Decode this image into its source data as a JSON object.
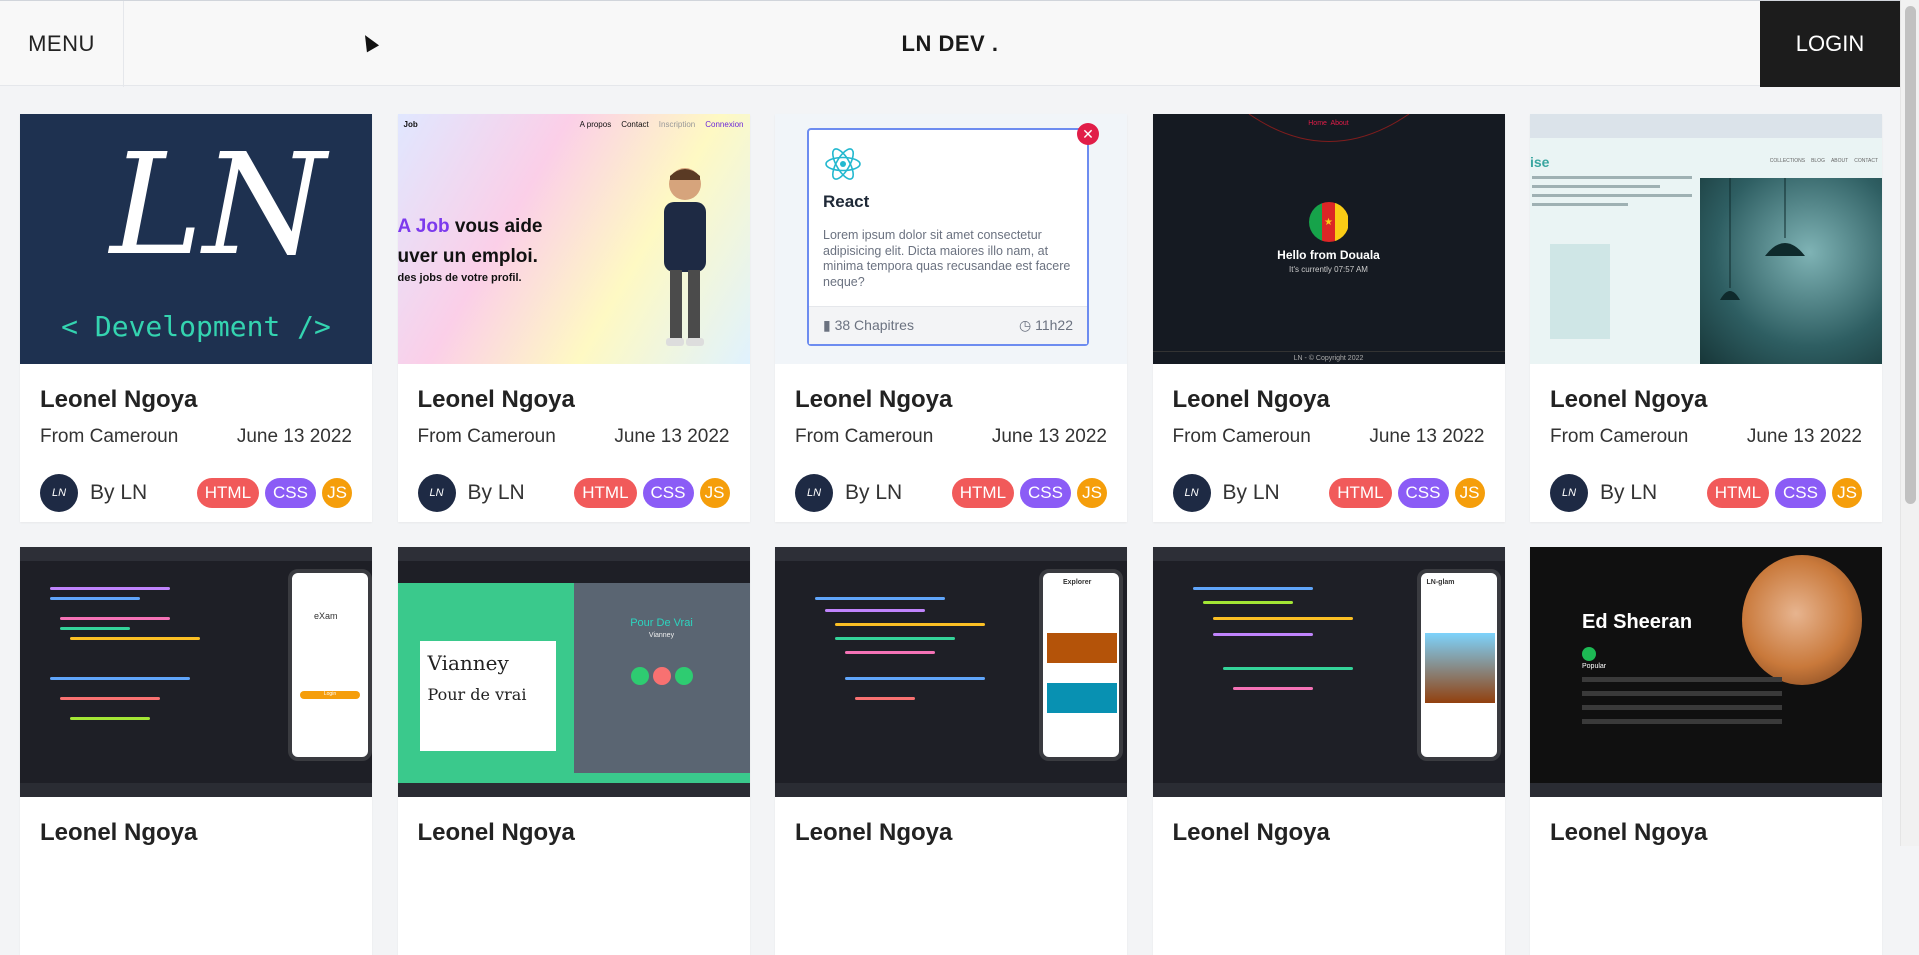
{
  "header": {
    "menu_label": "MENU",
    "brand": "LN DEV .",
    "login_label": "LOGIN"
  },
  "cards": [
    {
      "title": "Leonel Ngoya",
      "origin": "From Cameroun",
      "date": "June 13 2022",
      "author": "By LN",
      "tags": [
        "HTML",
        "CSS",
        "JS"
      ],
      "thumb": "ln-development"
    },
    {
      "title": "Leonel Ngoya",
      "origin": "From Cameroun",
      "date": "June 13 2022",
      "author": "By LN",
      "tags": [
        "HTML",
        "CSS",
        "JS"
      ],
      "thumb": "job-site"
    },
    {
      "title": "Leonel Ngoya",
      "origin": "From Cameroun",
      "date": "June 13 2022",
      "author": "By LN",
      "tags": [
        "HTML",
        "CSS",
        "JS"
      ],
      "thumb": "react-card"
    },
    {
      "title": "Leonel Ngoya",
      "origin": "From Cameroun",
      "date": "June 13 2022",
      "author": "By LN",
      "tags": [
        "HTML",
        "CSS",
        "JS"
      ],
      "thumb": "hello-douala"
    },
    {
      "title": "Leonel Ngoya",
      "origin": "From Cameroun",
      "date": "June 13 2022",
      "author": "By LN",
      "tags": [
        "HTML",
        "CSS",
        "JS"
      ],
      "thumb": "lamp-shop"
    },
    {
      "title": "Leonel Ngoya",
      "thumb": "code-exam-app"
    },
    {
      "title": "Leonel Ngoya",
      "thumb": "vianney-player"
    },
    {
      "title": "Leonel Ngoya",
      "thumb": "code-booking-app"
    },
    {
      "title": "Leonel Ngoya",
      "thumb": "code-social-app"
    },
    {
      "title": "Leonel Ngoya",
      "thumb": "ed-sheeran-player"
    }
  ],
  "thumbs": {
    "ln_development": {
      "logo_text": "LN",
      "caption": "< Development />"
    },
    "job_site": {
      "brand": "Job",
      "nav": [
        "A propos",
        "Contact",
        "Inscription",
        "Connexion"
      ],
      "headline_a": "A Job",
      "headline_b": " vous aide",
      "headline_c": "uver un emploi.",
      "sub": "des jobs de votre profil."
    },
    "react_card": {
      "title": "React",
      "text": "Lorem ipsum dolor sit amet consectetur adipisicing elit. Dicta maiores illo nam, at minima tempora quas recusandae est facere neque?",
      "chapters": "38 Chapitres",
      "duration": "11h22"
    },
    "hello_douala": {
      "nav": [
        "Home",
        "About"
      ],
      "hello": "Hello from Douala",
      "current": "It's currently 07:57 AM",
      "footer": "LN - © Copyright 2022"
    },
    "lamp_shop": {
      "logo": "ise",
      "nav": [
        "COLLECTIONS",
        "BLOG",
        "ABOUT",
        "CONTACT"
      ]
    },
    "code_exam_app": {
      "app_name": "eXam",
      "button": "Login"
    },
    "vianney_player": {
      "card_title": "Vianney",
      "card_sub": "Pour de vrai",
      "song": "Pour De Vrai",
      "artist": "Vianney"
    },
    "code_booking_app": {
      "title": "Explorer"
    },
    "code_social_app": {
      "title": "LN-glam"
    },
    "ed_sheeran_player": {
      "artist": "Ed Sheeran",
      "section": "Popular"
    }
  }
}
